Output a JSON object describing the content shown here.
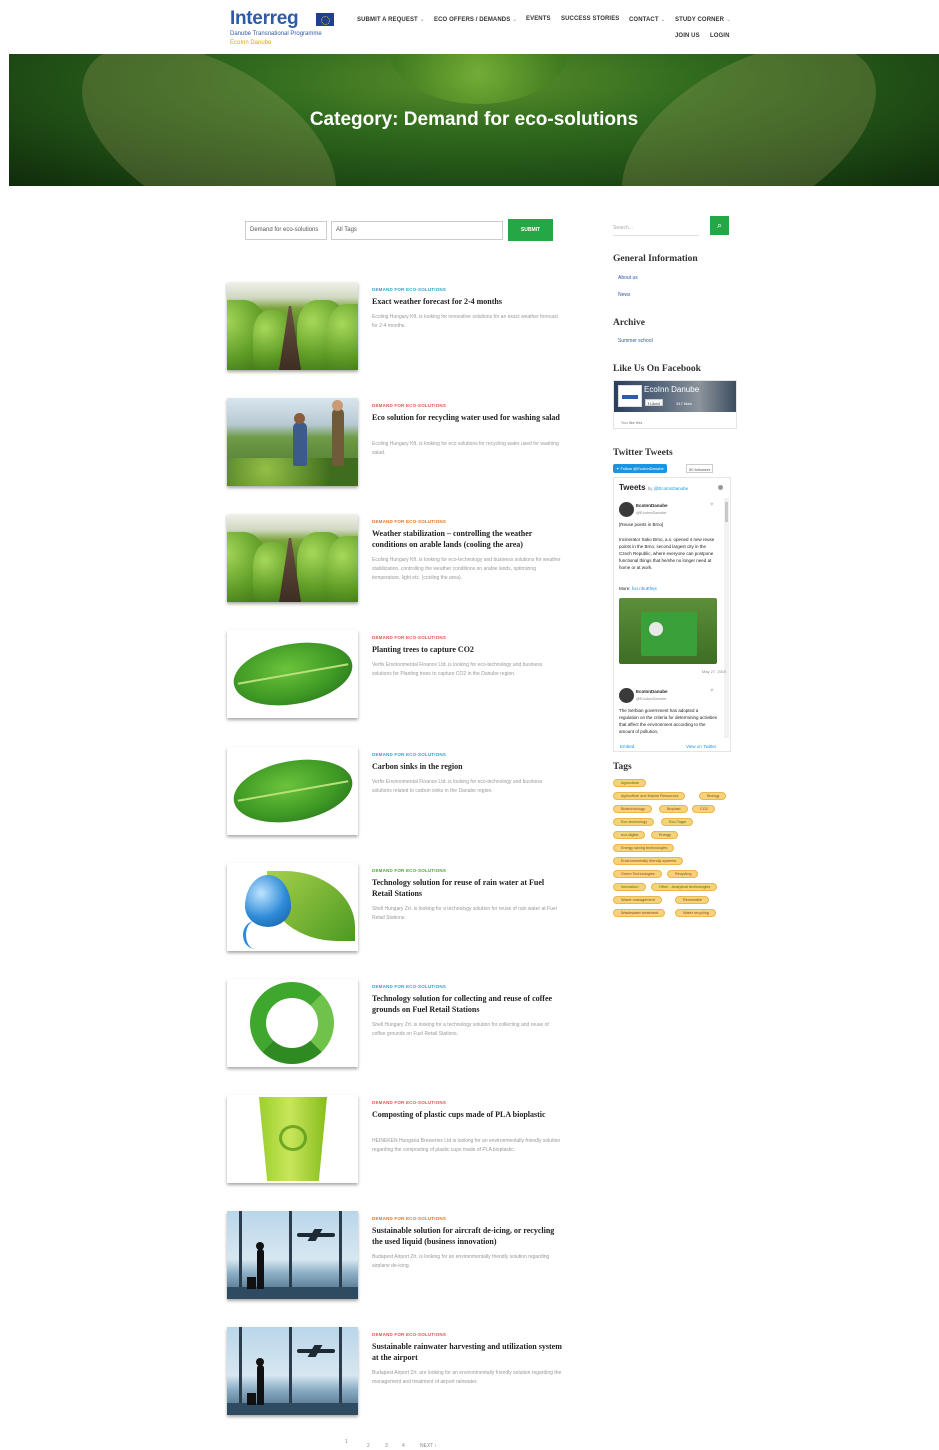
{
  "header": {
    "logo_word": "Interreg",
    "logo_sub": "Danube Transnational Programme",
    "logo_sub2": "EcoInn Danube",
    "nav": [
      {
        "label": "SUBMIT A REQUEST",
        "caret": true
      },
      {
        "label": "ECO OFFERS / DEMANDS",
        "caret": true
      },
      {
        "label": "EVENTS",
        "caret": false
      },
      {
        "label": "SUCCESS STORIES",
        "caret": false
      },
      {
        "label": "CONTACT",
        "caret": true
      },
      {
        "label": "STUDY CORNER",
        "caret": true
      }
    ],
    "nav2": [
      {
        "label": "JOIN US"
      },
      {
        "label": "LOGIN"
      }
    ]
  },
  "hero": {
    "title": "Category: Demand for eco-solutions"
  },
  "filter": {
    "category_value": "Demand for eco-solutions",
    "tags_value": "All Tags",
    "submit_label": "SUBMIT"
  },
  "posts": [
    {
      "category": "DEMAND FOR ECO-SOLUTIONS",
      "category_color": "#2ea3c9",
      "title": "Exact weather forecast for 2-4 months",
      "excerpt": "Ecoling Hungary Kft. is looking for innovative solutions for an exact weather forecast for 2-4 months.",
      "image": "lettuce-rows"
    },
    {
      "category": "DEMAND FOR ECO-SOLUTIONS",
      "category_color": "#e0564a",
      "title": "Eco solution for recycling water used for washing salad",
      "excerpt": "Ecoling Hungary Kft. is looking for eco solutions for recycling water used for washing salad.",
      "image": "garden-workers"
    },
    {
      "category": "DEMAND FOR ECO-SOLUTIONS",
      "category_color": "#e2741f",
      "title": "Weather stabilization – controlling the weather conditions on arable lands (cooling the area)",
      "excerpt": "Ecoling Hungary Kft. is looking for eco-technology and business solutions for weather stabilization, controlling the weather conditions on arable lands, optimizing temperature, light etc. (cooling the area).",
      "image": "lettuce-rows"
    },
    {
      "category": "DEMAND FOR ECO-SOLUTIONS",
      "category_color": "#e0564a",
      "title": "Planting trees to capture CO2",
      "excerpt": "Verfix Environmental Finance Ltd. is looking for eco-technology and business solutions for Planting trees to capture CO2 in the Danube region.",
      "image": "green-leaf"
    },
    {
      "category": "DEMAND FOR ECO-SOLUTIONS",
      "category_color": "#2ea3c9",
      "title": "Carbon sinks in the region",
      "excerpt": "Verfix Environmental Finance Ltd. is looking for eco-technology and business solutions related to carbon sinks in the Danube region.",
      "image": "green-leaf"
    },
    {
      "category": "DEMAND FOR ECO-SOLUTIONS",
      "category_color": "#4aa832",
      "title": "Technology solution for reuse of rain water at Fuel Retail Stations",
      "excerpt": "Shell Hungary Zrt. is looking for a technology solution for reuse of rain water at Fuel Retail Stations.",
      "image": "water-drop-leaf"
    },
    {
      "category": "DEMAND FOR ECO-SOLUTIONS",
      "category_color": "#2ea3c9",
      "title": "Technology solution for collecting and reuse of coffee grounds on Fuel Retail Stations",
      "excerpt": "Shell Hungary Zrt. is looking for a technology solution for collecting and reuse of coffee grounds on Fuel Retail Stations.",
      "image": "recycle-arrows"
    },
    {
      "category": "DEMAND FOR ECO-SOLUTIONS",
      "category_color": "#e0564a",
      "title": "Composting of plastic cups made of PLA bioplastic",
      "excerpt": "HEINEKEN Hungária Breweries Ltd is looking for an environmentally friendly solution regarding the composting of plastic cups made of PLA bioplastic.",
      "image": "green-cup"
    },
    {
      "category": "DEMAND FOR ECO-SOLUTIONS",
      "category_color": "#e2741f",
      "title": "Sustainable solution for aircraft de-icing, or recycling the used liquid (business innovation)",
      "excerpt": "Budapest Airport Zrt. is looking for an environmentally friendly solution regarding airplane de-icing.",
      "image": "airport"
    },
    {
      "category": "DEMAND FOR ECO-SOLUTIONS",
      "category_color": "#e0564a",
      "title": "Sustainable rainwater harvesting and utilization system at the airport",
      "excerpt": "Budapest Airport Zrt. are looking for an environmentally friendly solution regarding the management and treatment of airport rainwater.",
      "image": "airport"
    }
  ],
  "pagination": {
    "pages": [
      "1",
      "2",
      "3",
      "4"
    ],
    "current": "1",
    "next": "NEXT ›"
  },
  "sidebar": {
    "search_placeholder": "Search...",
    "general_title": "General Information",
    "general_links": [
      "About us",
      "News"
    ],
    "archive_title": "Archive",
    "archive_links": [
      "Summer school"
    ],
    "facebook_title": "Like Us On Facebook",
    "facebook": {
      "page_name": "EcoInn Danube",
      "like_label": "Liked",
      "followers": "347 likes",
      "like_text": "You like this"
    },
    "twitter_title": "Twitter Tweets",
    "twitter": {
      "follow_label": "Follow @EcoInnDanube",
      "followers_label": "50 followers",
      "tweets_label": "Tweets",
      "by_label": "by",
      "by_handle": "@EcoInnDanube",
      "tweet1": {
        "name": "EcoInnDanube",
        "handle": "@EcoInnDanube",
        "text_head": "[Reuse points in Brno]",
        "text_body": "Incinerator Sako Brno, a.s. opened 4 new reuse points in the Brno, second largest city in the Czech Republic, where everyone can postpone functional things that he/she no longer need at home or at work.",
        "more_label": "More:",
        "link": "fun.nbuEfejs",
        "date": "May 27, 2019"
      },
      "tweet2": {
        "name": "EcoInnDanube",
        "handle": "@EcoInnDanube",
        "text": "The Serbian government has adopted a regulation on the criteria for determining activities that affect the environment according to the amount of pollution,"
      },
      "embed_label": "Embed",
      "view_label": "View on Twitter"
    },
    "tags_title": "Tags",
    "tags": [
      "Agriculture",
      "Agriculture and Marine Resources",
      "Biology",
      "Biotechnology",
      "Bioplast",
      "CO2",
      "Eco-technology",
      "Eco-Tagai",
      "eco-digital",
      "Energy",
      "Energy saving technologies",
      "Environmentally friendly systems",
      "Green Technologies",
      "Recycling",
      "Innovation",
      "Other - Analytical technologies",
      "Waste management",
      "Renewable",
      "Wastewater treatment",
      "Water recycling"
    ]
  }
}
